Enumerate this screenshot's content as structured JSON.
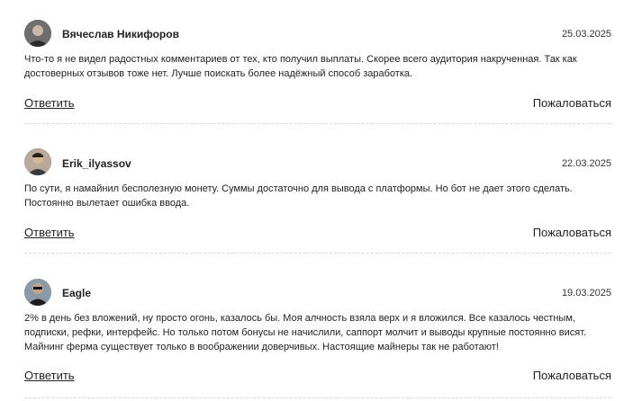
{
  "comments": [
    {
      "author": "Вячеслав Никифоров",
      "date": "25.03.2025",
      "text": "Что-то я не видел радостных комментариев от тех, кто получил выплаты. Скорее всего аудитория накрученная. Так как достоверных отзывов тоже нет. Лучше поискать более надёжный способ заработка.",
      "reply_label": "Ответить",
      "report_label": "Пожаловаться"
    },
    {
      "author": "Erik_ilyassov",
      "date": "22.03.2025",
      "text": "По сути, я намайнил бесполезную монету. Суммы достаточно для вывода с платформы. Но бот не дает этого сделать. Постоянно вылетает ошибка ввода.",
      "reply_label": "Ответить",
      "report_label": "Пожаловаться"
    },
    {
      "author": "Eagle",
      "date": "19.03.2025",
      "text": "2% в день без вложений, ну просто огонь, казалось бы. Моя алчность взяла верх и я вложился. Все казалось честным, подписки, рефки, интерфейс. Но только потом бонусы не начислили, саппорт молчит и выводы крупные постоянно висят. Майнинг ферма существует только в воображении доверчивых. Настоящие майнеры так не работают!",
      "reply_label": "Ответить",
      "report_label": "Пожаловаться"
    }
  ]
}
